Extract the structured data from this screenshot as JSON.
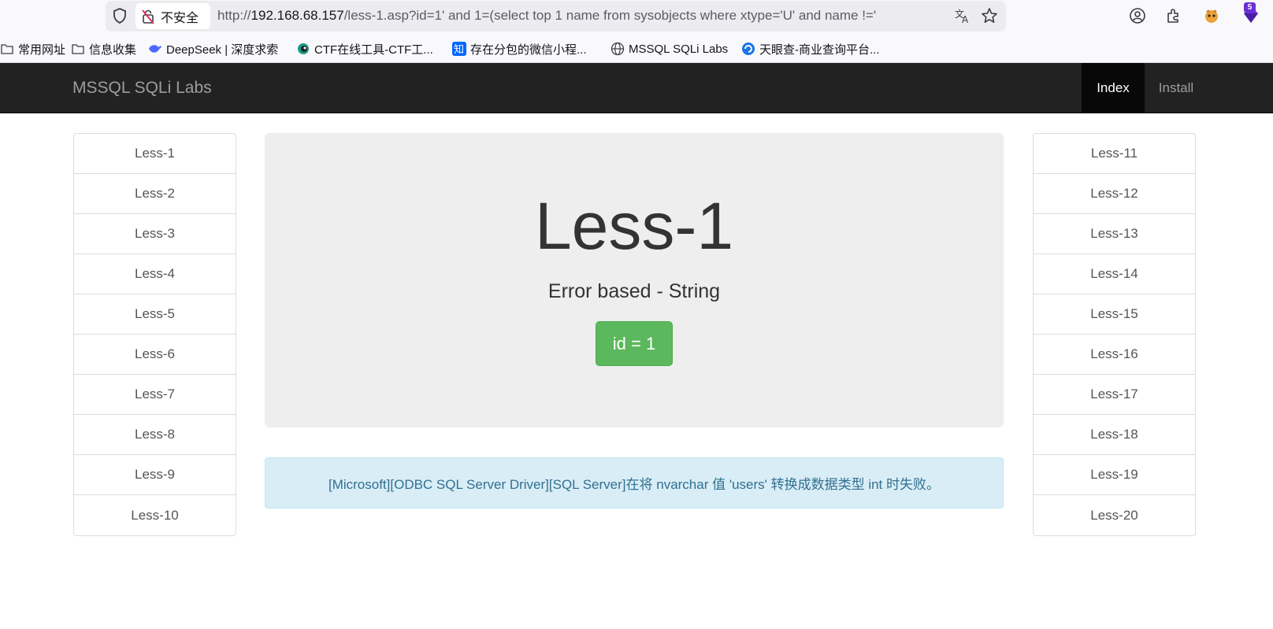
{
  "browser": {
    "secure_label": "不安全",
    "url_prefix": "http://",
    "url_host": "192.168.68.157",
    "url_rest": "/less-1.asp?id=1' and 1=(select top 1 name from sysobjects where xtype='U' and name !='",
    "extension_badge": "5",
    "accent": "#6b2fd6"
  },
  "bookmarks": [
    {
      "label": "常用网址",
      "icon": "folder-icon"
    },
    {
      "label": "信息收集",
      "icon": "folder-icon"
    },
    {
      "label": "DeepSeek | 深度求索",
      "icon": "deepseek-icon"
    },
    {
      "label": "CTF在线工具-CTF工...",
      "icon": "ctf-icon"
    },
    {
      "label": "存在分包的微信小程...",
      "icon": "zhihu-icon"
    },
    {
      "label": "MSSQL SQLi Labs",
      "icon": "globe-icon"
    },
    {
      "label": "天眼查-商业查询平台...",
      "icon": "tianyancha-icon"
    }
  ],
  "navbar": {
    "brand": "MSSQL SQLi Labs",
    "items": [
      "Index",
      "Install"
    ]
  },
  "left_list": [
    "Less-1",
    "Less-2",
    "Less-3",
    "Less-4",
    "Less-5",
    "Less-6",
    "Less-7",
    "Less-8",
    "Less-9",
    "Less-10"
  ],
  "right_list": [
    "Less-11",
    "Less-12",
    "Less-13",
    "Less-14",
    "Less-15",
    "Less-16",
    "Less-17",
    "Less-18",
    "Less-19",
    "Less-20"
  ],
  "main": {
    "title": "Less-1",
    "subtitle": "Error based - String",
    "id_button": "id = 1"
  },
  "alert": {
    "message": "[Microsoft][ODBC SQL Server Driver][SQL Server]在将 nvarchar 值 'users' 转换成数据类型 int 时失败。"
  },
  "colors": {
    "navbar_bg": "#222222",
    "success": "#5cb85c",
    "info_bg": "#d9edf7",
    "info_text": "#31708f"
  }
}
